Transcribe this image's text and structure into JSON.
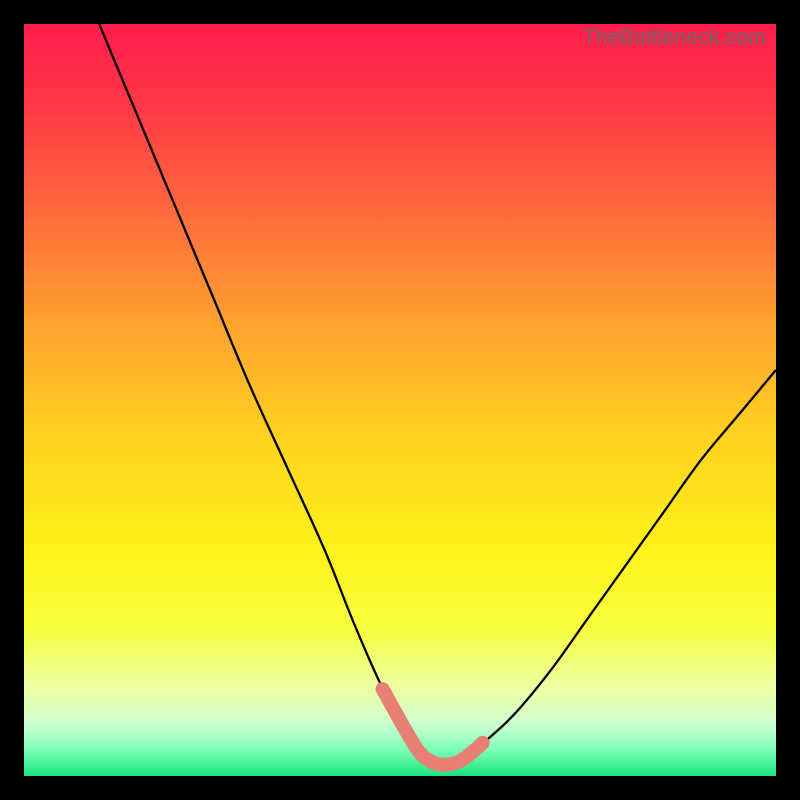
{
  "watermark": "TheBottleneck.com",
  "colors": {
    "frame": "#000000",
    "curve_stroke": "#000000",
    "highlight_stroke": "#e77f74",
    "gradient_stops": [
      {
        "offset": 0.0,
        "color": "#ff1d4b"
      },
      {
        "offset": 0.1,
        "color": "#ff3547"
      },
      {
        "offset": 0.25,
        "color": "#ff6a3c"
      },
      {
        "offset": 0.4,
        "color": "#ffa22f"
      },
      {
        "offset": 0.55,
        "color": "#ffd21f"
      },
      {
        "offset": 0.7,
        "color": "#fff21a"
      },
      {
        "offset": 0.8,
        "color": "#f8ff3c"
      },
      {
        "offset": 0.88,
        "color": "#ecffa0"
      },
      {
        "offset": 0.93,
        "color": "#cfffd0"
      },
      {
        "offset": 0.965,
        "color": "#7dffb8"
      },
      {
        "offset": 1.0,
        "color": "#18e57f"
      }
    ]
  },
  "chart_data": {
    "type": "line",
    "title": "",
    "xlabel": "",
    "ylabel": "",
    "xlim": [
      0,
      100
    ],
    "ylim": [
      0,
      100
    ],
    "series": [
      {
        "name": "bottleneck-curve",
        "x": [
          10,
          15,
          20,
          25,
          30,
          35,
          40,
          44,
          48,
          52,
          54,
          56,
          58,
          60,
          65,
          70,
          75,
          80,
          85,
          90,
          95,
          100
        ],
        "y": [
          100,
          88,
          76,
          64,
          52,
          41,
          30,
          20,
          11,
          4,
          2,
          1.5,
          2,
          3.5,
          8,
          14,
          21,
          28,
          35,
          42,
          48,
          54
        ]
      }
    ],
    "optimal_range_x": [
      48,
      61
    ],
    "annotations": []
  }
}
